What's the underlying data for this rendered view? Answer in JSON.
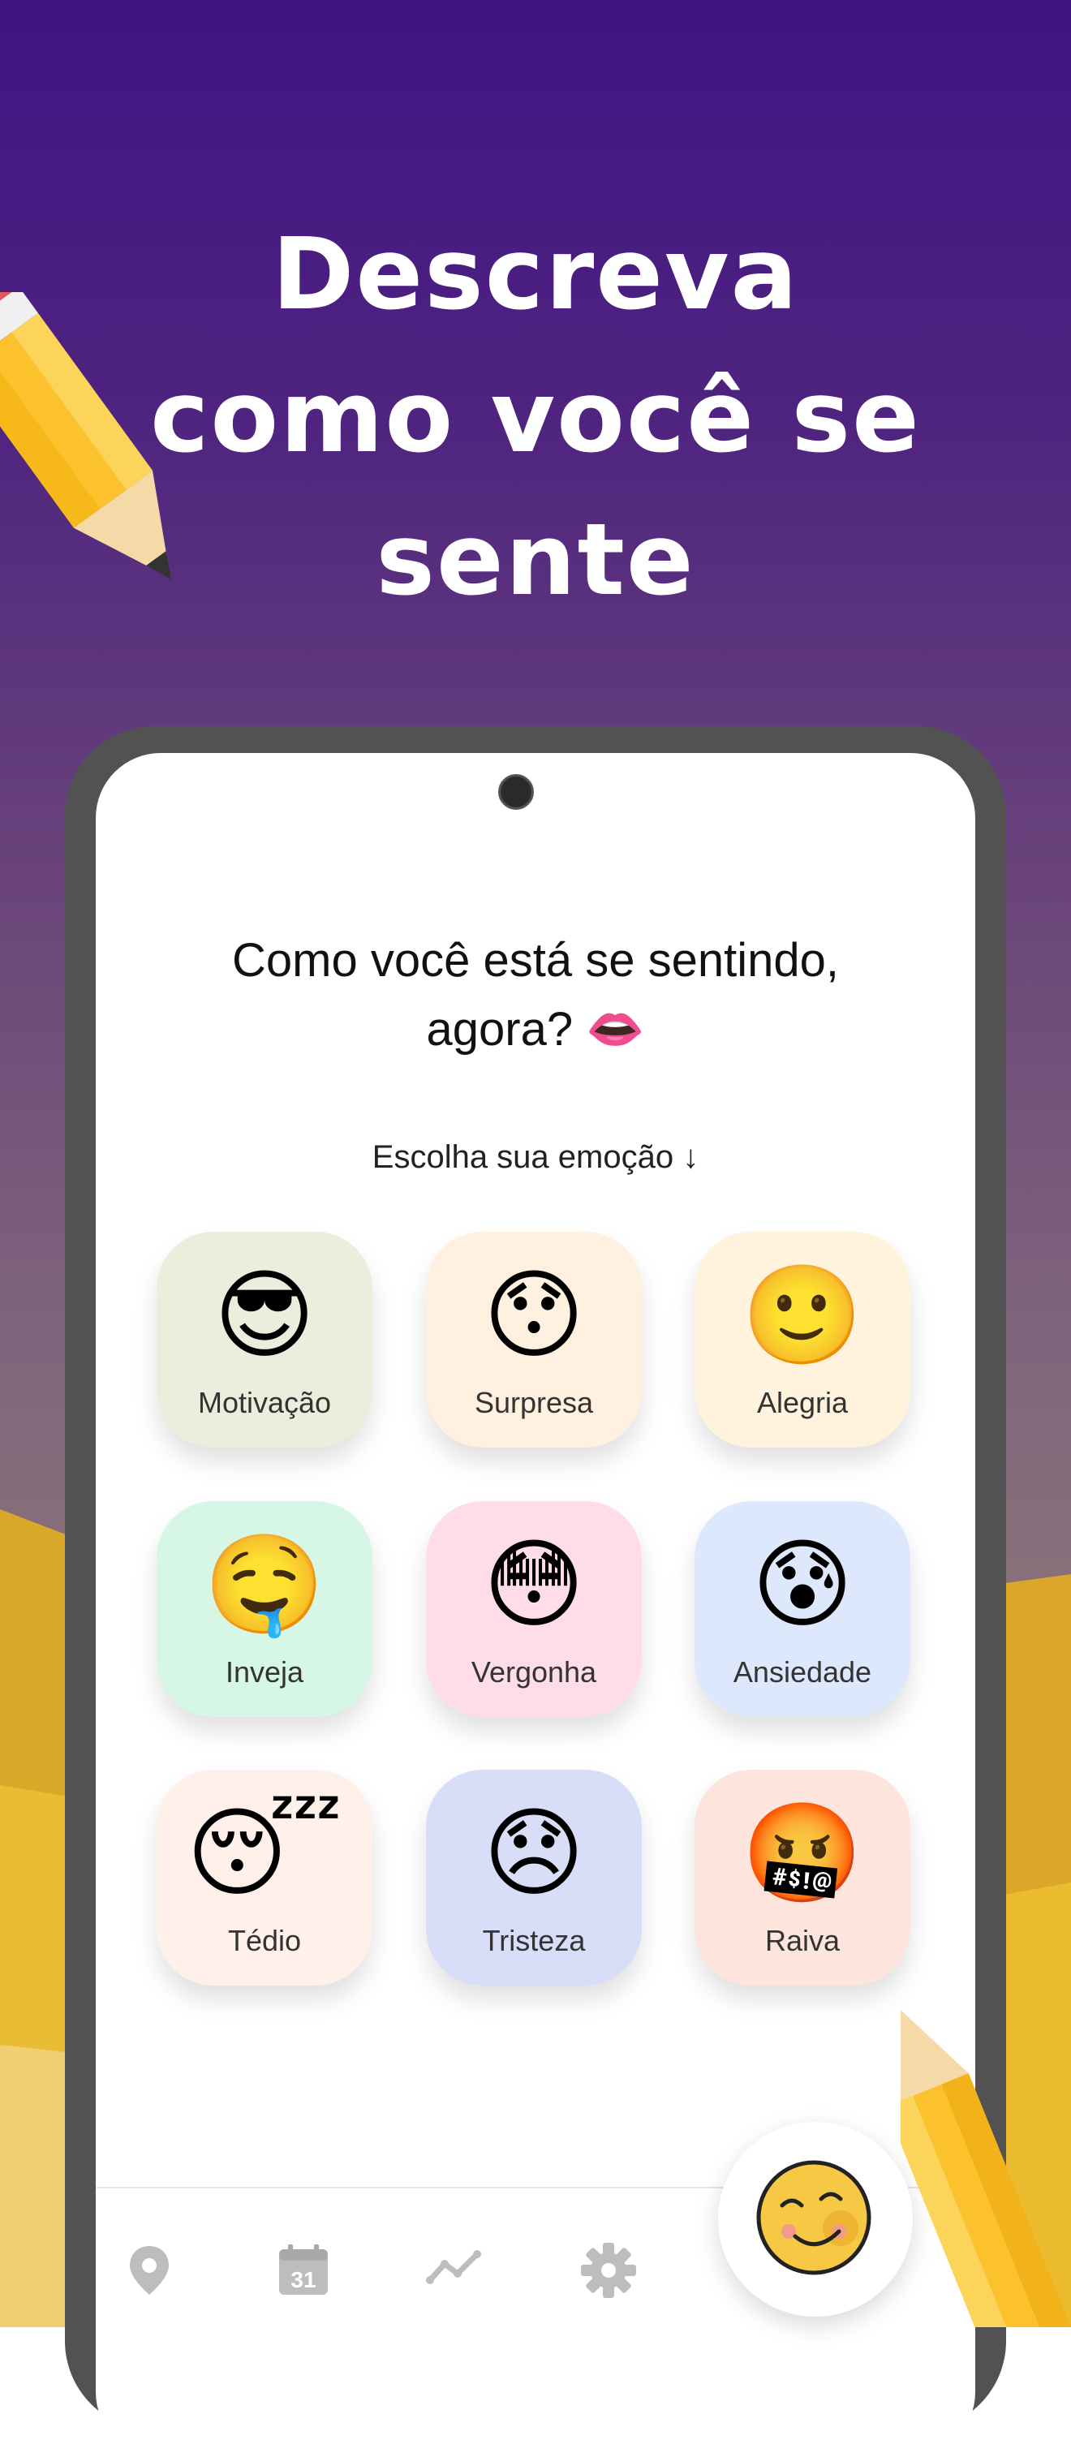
{
  "headline": {
    "line1": "Descreva",
    "line2": "como você se",
    "line3": "sente"
  },
  "screen": {
    "question_line1": "Como você está se sentindo,",
    "question_line2": "agora? 👄",
    "choose_label": "Escolha sua emoção",
    "choose_arrow": "↓"
  },
  "emotions": [
    {
      "emoji": "😎",
      "label": "Motivação",
      "color": "#ebeedd"
    },
    {
      "emoji": "😯",
      "label": "Surpresa",
      "color": "#fff0df"
    },
    {
      "emoji": "🙂",
      "label": "Alegria",
      "color": "#fff3dd"
    },
    {
      "emoji": "🤤",
      "label": "Inveja",
      "color": "#d7f7e6"
    },
    {
      "emoji": "😳",
      "label": "Vergonha",
      "color": "#ffdde6"
    },
    {
      "emoji": "😰",
      "label": "Ansiedade",
      "color": "#dde8fd"
    },
    {
      "emoji": "😴",
      "label": "Tédio",
      "color": "#fff0ea"
    },
    {
      "emoji": "😞",
      "label": "Tristeza",
      "color": "#d8ddf8"
    },
    {
      "emoji": "🤬",
      "label": "Raiva",
      "color": "#fde5dd"
    }
  ],
  "nav": {
    "items": [
      "location-icon",
      "calendar-icon",
      "chart-icon",
      "settings-icon"
    ],
    "calendar_day": "31",
    "fab_icon": "smiling-face-icon"
  }
}
